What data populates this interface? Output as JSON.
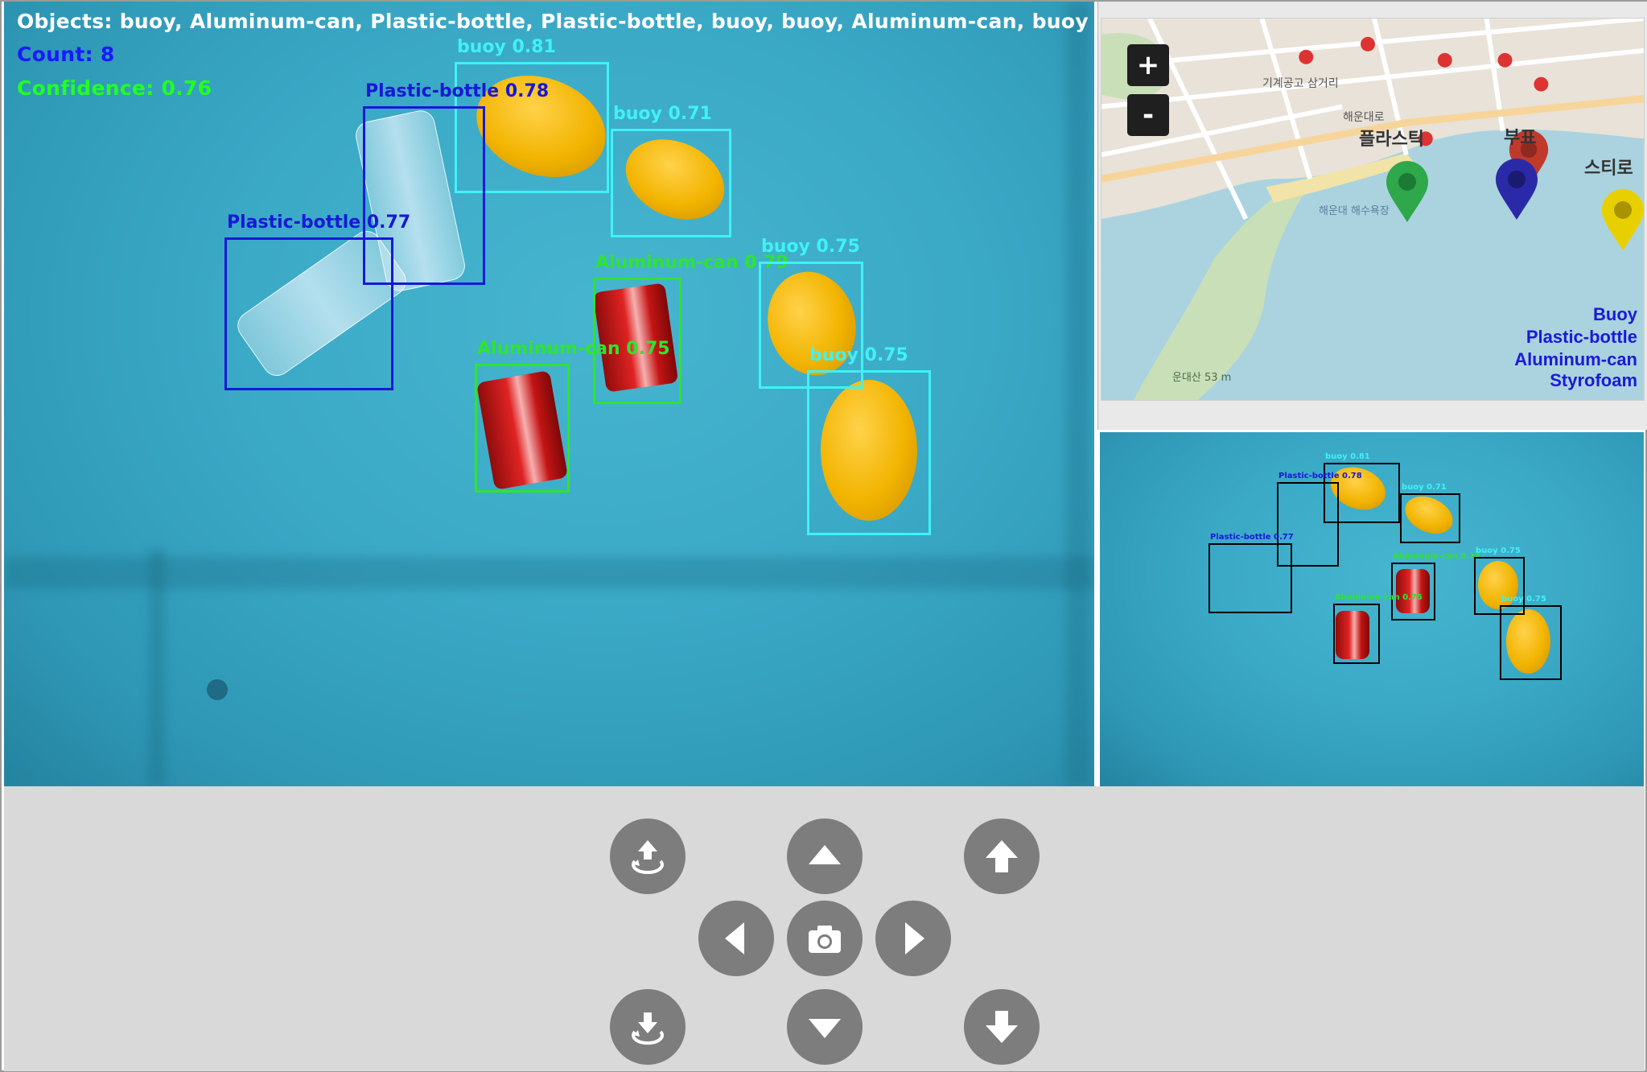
{
  "overlay": {
    "objects_text": "Objects: buoy, Aluminum-can, Plastic-bottle, Plastic-bottle, buoy, buoy, Aluminum-can, buoy",
    "count_text": "Count: 8",
    "confidence_text": "Confidence: 0.76"
  },
  "detections": [
    {
      "label": "buoy 0.81"
    },
    {
      "label": "Plastic-bottle 0.78"
    },
    {
      "label": "buoy 0.71"
    },
    {
      "label": "Plastic-bottle 0.77"
    },
    {
      "label": "Aluminum-can 0.79"
    },
    {
      "label": "buoy 0.75"
    },
    {
      "label": "Aluminum-can 0.75"
    },
    {
      "label": "buoy 0.75"
    }
  ],
  "map": {
    "zoom_in_label": "+",
    "zoom_out_label": "-",
    "legend": [
      "Buoy",
      "Plastic-bottle",
      "Aluminum-can",
      "Styrofoam"
    ],
    "place_labels": [
      "해운대 해수욕장",
      "운대산 53 m",
      "기계공고 삼거리",
      "해운대로",
      "플라스틱",
      "부표",
      "스티로"
    ],
    "colors": {
      "buoy_marker": "#2d7d9a",
      "bottle_marker": "#2a2aa8",
      "can_marker": "#2ea84a",
      "styro_marker": "#e8d000",
      "red_marker": "#c0392b"
    }
  },
  "controls": {
    "icons": [
      "rotate-up-icon",
      "arrow-up-icon",
      "ascend-icon",
      "arrow-left-icon",
      "camera-icon",
      "arrow-right-icon",
      "rotate-down-icon",
      "arrow-down-icon",
      "descend-icon"
    ]
  }
}
